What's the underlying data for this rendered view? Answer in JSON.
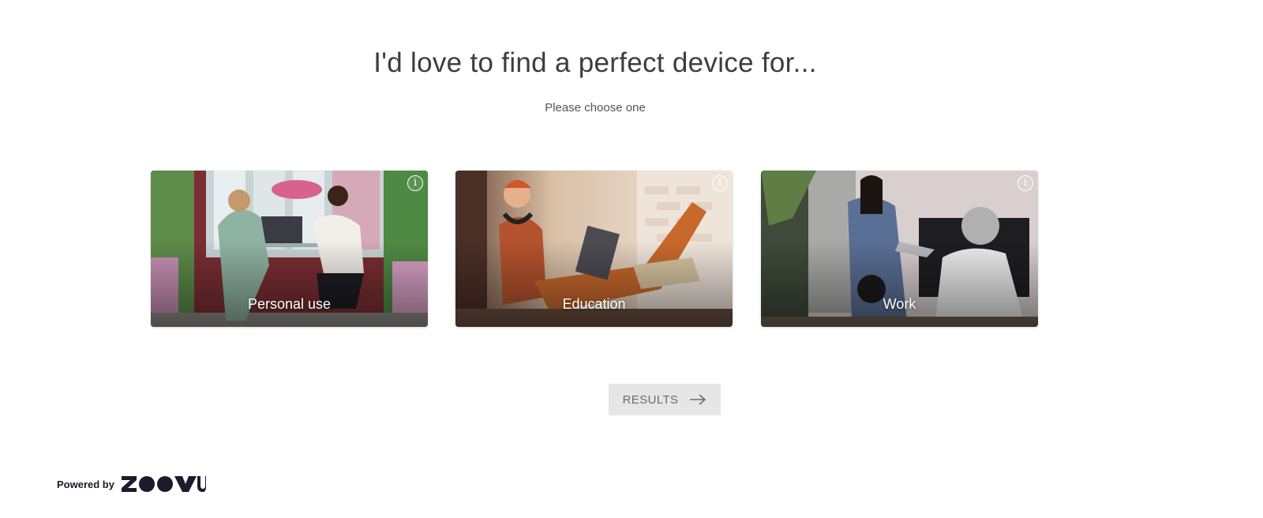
{
  "header": {
    "title": "I'd love to find a perfect device for...",
    "subtitle": "Please choose one"
  },
  "options": [
    {
      "label": "Personal use",
      "info_icon": "info-icon"
    },
    {
      "label": "Education",
      "info_icon": "info-icon"
    },
    {
      "label": "Work",
      "info_icon": "info-icon"
    }
  ],
  "results_button": {
    "label": "RESULTS",
    "icon": "arrow-right-icon"
  },
  "footer": {
    "powered_by": "Powered by",
    "brand": "ZOOVU"
  },
  "colors": {
    "button_bg": "#e6e6e6",
    "button_text": "#6b6b6b",
    "brand": "#1b1b2b"
  }
}
